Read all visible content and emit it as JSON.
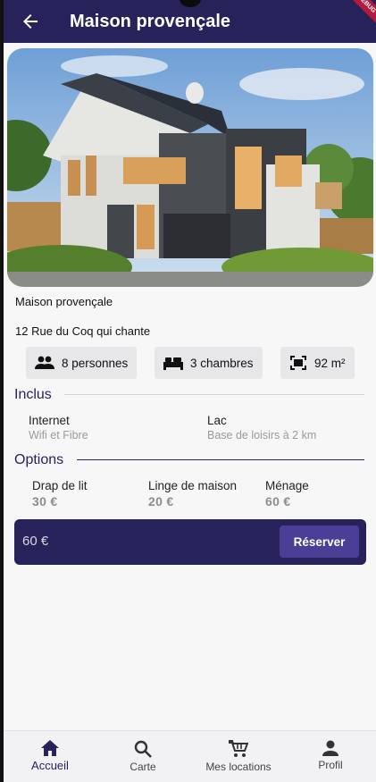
{
  "appbar": {
    "title": "Maison provençale",
    "back_icon": "arrow-back-icon",
    "ribbon": "DEBUG"
  },
  "listing": {
    "name": "Maison provençale",
    "address": "12 Rue du Coq qui chante",
    "features": [
      {
        "icon": "people-icon",
        "label": "8 personnes"
      },
      {
        "icon": "bed-icon",
        "label": "3 chambres"
      },
      {
        "icon": "area-icon",
        "label": "92 m²"
      }
    ]
  },
  "included": {
    "heading": "Inclus",
    "items": [
      {
        "title": "Internet",
        "subtitle": "Wifi et Fibre"
      },
      {
        "title": "Lac",
        "subtitle": "Base de loisirs à 2 km"
      }
    ]
  },
  "options": {
    "heading": "Options",
    "items": [
      {
        "title": "Drap de lit",
        "price": "30 €"
      },
      {
        "title": "Linge de maison",
        "price": "20 €"
      },
      {
        "title": "Ménage",
        "price": "60 €"
      }
    ]
  },
  "booking": {
    "total": "60 €",
    "reserve_label": "Réserver"
  },
  "nav": {
    "items": [
      {
        "icon": "home-icon",
        "label": "Accueil",
        "active": true
      },
      {
        "icon": "search-icon",
        "label": "Carte",
        "active": false
      },
      {
        "icon": "cart-icon",
        "label": "Mes locations",
        "active": false
      },
      {
        "icon": "person-icon",
        "label": "Profil",
        "active": false
      }
    ]
  },
  "colors": {
    "primary": "#27225a",
    "button": "#4a3e96",
    "background": "#f7f7f8",
    "chip": "#e7e7e9"
  }
}
